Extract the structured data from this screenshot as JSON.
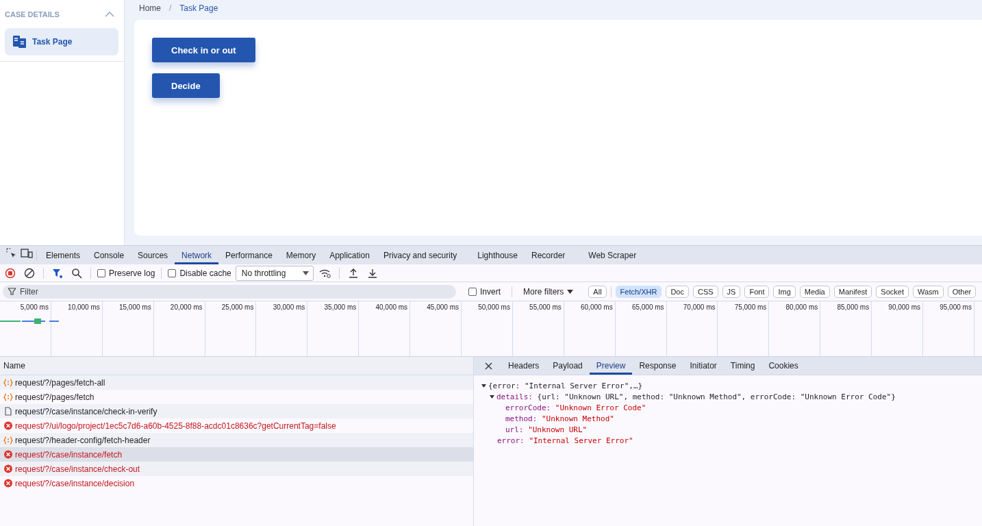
{
  "sidebar": {
    "section_title": "CASE DETAILS",
    "expanded": true,
    "items": [
      {
        "label": "Task Page",
        "selected": true
      }
    ]
  },
  "breadcrumb": [
    {
      "label": "Home",
      "kind": "link"
    },
    {
      "label": "/",
      "kind": "separator"
    },
    {
      "label": "Task Page",
      "kind": "current"
    }
  ],
  "actions": [
    "Check in or out",
    "Decide"
  ],
  "devtools": {
    "tabs": [
      {
        "label": "Elements",
        "selected": false
      },
      {
        "label": "Console",
        "selected": false
      },
      {
        "label": "Sources",
        "selected": false
      },
      {
        "label": "Network",
        "selected": true
      },
      {
        "label": "Performance",
        "selected": false
      },
      {
        "label": "Memory",
        "selected": false
      },
      {
        "label": "Application",
        "selected": false
      },
      {
        "label": "Privacy and security",
        "selected": false
      },
      {
        "label": "Lighthouse",
        "selected": false
      },
      {
        "label": "Recorder",
        "selected": false
      },
      {
        "label": "Web Scraper",
        "selected": false
      }
    ],
    "toolbar": {
      "preserve_log": {
        "label": "Preserve log",
        "checked": false
      },
      "disable_cache": {
        "label": "Disable cache",
        "checked": false
      },
      "throttling": "No throttling"
    },
    "filter": {
      "placeholder": "Filter",
      "invert": {
        "label": "Invert",
        "checked": false
      },
      "more_filters": "More filters",
      "types": [
        {
          "label": "All",
          "selected": false
        },
        {
          "label": "Fetch/XHR",
          "selected": true
        },
        {
          "label": "Doc",
          "selected": false
        },
        {
          "label": "CSS",
          "selected": false
        },
        {
          "label": "JS",
          "selected": false
        },
        {
          "label": "Font",
          "selected": false
        },
        {
          "label": "Img",
          "selected": false
        },
        {
          "label": "Media",
          "selected": false
        },
        {
          "label": "Manifest",
          "selected": false
        },
        {
          "label": "Socket",
          "selected": false
        },
        {
          "label": "Wasm",
          "selected": false
        },
        {
          "label": "Other",
          "selected": false
        }
      ]
    },
    "timeline_ticks": [
      "5,000 ms",
      "10,000 ms",
      "15,000 ms",
      "20,000 ms",
      "25,000 ms",
      "30,000 ms",
      "35,000 ms",
      "40,000 ms",
      "45,000 ms",
      "50,000 ms",
      "55,000 ms",
      "60,000 ms",
      "65,000 ms",
      "70,000 ms",
      "75,000 ms",
      "80,000 ms",
      "85,000 ms",
      "90,000 ms",
      "95,000 ms"
    ],
    "requests_header": "Name",
    "requests": [
      {
        "name": "request/?/pages/fetch-all",
        "kind": "xhr",
        "selected": false
      },
      {
        "name": "request/?/pages/fetch",
        "kind": "xhr",
        "selected": false
      },
      {
        "name": "request/?/case/instance/check-in-verify",
        "kind": "doc",
        "selected": false
      },
      {
        "name": "request/?/ui/logo/project/1ec5c7d6-a60b-4525-8f88-acdc01c8636c?getCurrentTag=false",
        "kind": "error",
        "selected": false
      },
      {
        "name": "request/?/header-config/fetch-header",
        "kind": "xhr",
        "selected": false
      },
      {
        "name": "request/?/case/instance/fetch",
        "kind": "error",
        "selected": true
      },
      {
        "name": "request/?/case/instance/check-out",
        "kind": "error",
        "selected": false
      },
      {
        "name": "request/?/case/instance/decision",
        "kind": "error",
        "selected": false
      }
    ],
    "detail_tabs": [
      {
        "label": "Headers",
        "selected": false
      },
      {
        "label": "Payload",
        "selected": false
      },
      {
        "label": "Preview",
        "selected": true
      },
      {
        "label": "Response",
        "selected": false
      },
      {
        "label": "Initiator",
        "selected": false
      },
      {
        "label": "Timing",
        "selected": false
      },
      {
        "label": "Cookies",
        "selected": false
      }
    ],
    "preview": [
      {
        "summary": "{error: \"Internal Server Error\",…}",
        "expanded": true,
        "children": [
          {
            "key": "details:",
            "summary": "{url: \"Unknown URL\", method: \"Unknown Method\", errorCode: \"Unknown Error Code\"}",
            "expanded": true,
            "children": [
              {
                "key": "errorCode:",
                "value": "\"Unknown Error Code\""
              },
              {
                "key": "method:",
                "value": "\"Unknown Method\""
              },
              {
                "key": "url:",
                "value": "\"Unknown URL\""
              }
            ]
          },
          {
            "key": "error:",
            "value": "\"Internal Server Error\""
          }
        ]
      }
    ]
  }
}
